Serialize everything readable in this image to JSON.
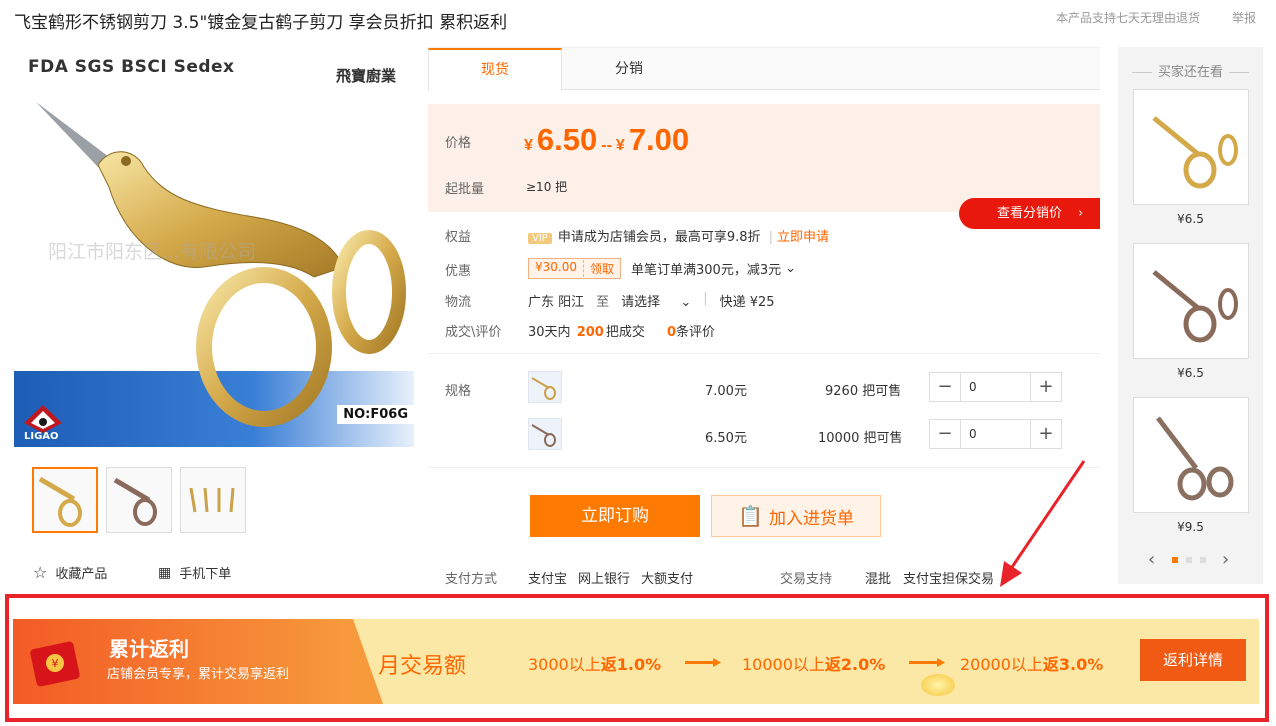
{
  "title": "飞宝鹤形不锈钢剪刀 3.5\"镀金复古鹤子剪刀 享会员折扣 累积返利",
  "top_links": {
    "return_policy": "本产品支持七天无理由退货",
    "report": "举报"
  },
  "gallery": {
    "certifications": "FDA SGS BSCI Sedex",
    "brand": "飛寶廚業",
    "watermark": "阳江市阳东区...有限公司",
    "model": "NO:F06G",
    "logo": "LIGAO",
    "actions": {
      "favorite": "收藏产品",
      "mobile": "手机下单"
    }
  },
  "tabs": [
    {
      "label": "现货"
    },
    {
      "label": "分销"
    }
  ],
  "price": {
    "label": "价格",
    "currency": "¥",
    "low": "6.50",
    "sep": "--",
    "high": "7.00",
    "moq_label": "起批量",
    "moq": "≥10 把"
  },
  "distribution_button": "查看分销价",
  "benefits": {
    "label": "权益",
    "vip": "VIP",
    "text": "申请成为店铺会员，最高可享9.8折",
    "link": "立即申请"
  },
  "discount": {
    "label": "优惠",
    "coupon_value": "¥30.00",
    "coupon_action": "领取",
    "text": "单笔订单满300元，减3元"
  },
  "logistics": {
    "label": "物流",
    "from": "广东 阳江",
    "to_word": "至",
    "select": "请选择",
    "express": "快递 ¥25"
  },
  "deals": {
    "label": "成交\\评价",
    "prefix": "30天内",
    "sold": "200",
    "sold_suffix": "把成交",
    "reviews": "0",
    "reviews_suffix": "条评价"
  },
  "sku": {
    "label": "规格",
    "items": [
      {
        "price": "7.00元",
        "stock": "9260 把可售",
        "qty": "0"
      },
      {
        "price": "6.50元",
        "stock": "10000 把可售",
        "qty": "0"
      }
    ]
  },
  "buttons": {
    "buy": "立即订购",
    "cart": "加入进货单"
  },
  "payment": {
    "label": "支付方式",
    "methods": [
      "支付宝",
      "网上银行",
      "大额支付"
    ],
    "support_label": "交易支持",
    "support": [
      "混批",
      "支付宝担保交易"
    ]
  },
  "sidebar": {
    "title": "买家还在看",
    "items": [
      {
        "price": "¥6.5"
      },
      {
        "price": "¥6.5"
      },
      {
        "price": "¥9.5"
      }
    ]
  },
  "rebate": {
    "title": "累计返利",
    "subtitle": "店铺会员专享，累计交易享返利",
    "monthly": "月交易额",
    "tiers": [
      {
        "threshold": "3000以上",
        "word": "返",
        "rate": "1.0%"
      },
      {
        "threshold": "10000以上",
        "word": "返",
        "rate": "2.0%"
      },
      {
        "threshold": "20000以上",
        "word": "返",
        "rate": "3.0%"
      }
    ],
    "button": "返利详情"
  },
  "colors": {
    "accent": "#ff7a00",
    "price": "#ff6600",
    "red": "#e8180c",
    "highlight_frame": "#e8232a"
  }
}
